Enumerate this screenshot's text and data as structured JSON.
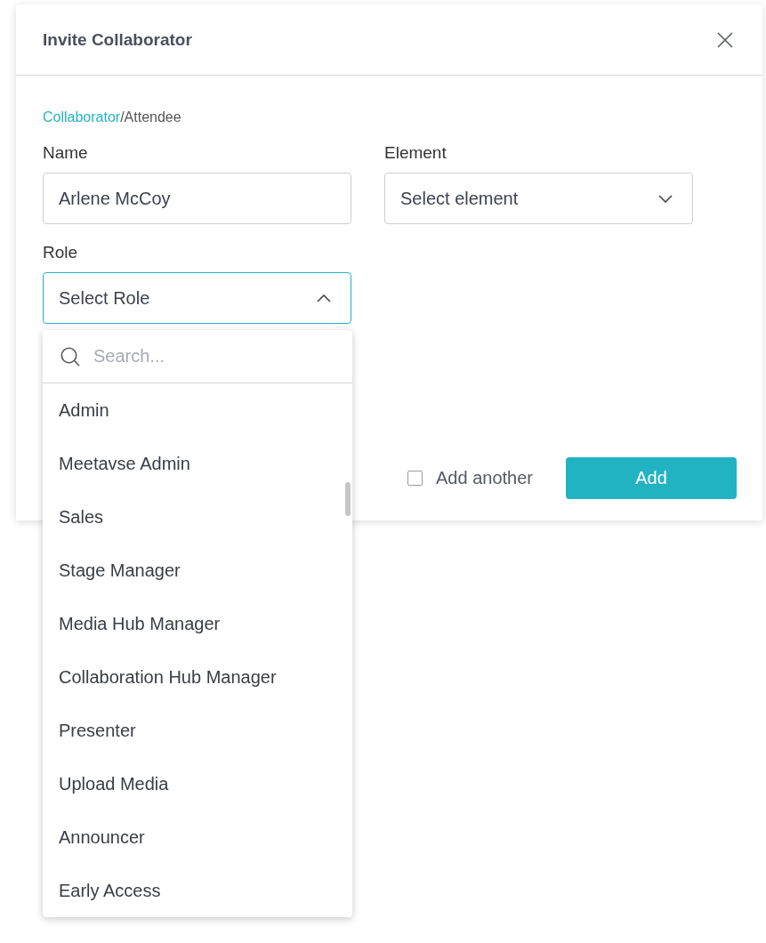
{
  "dialog": {
    "title": "Invite Collaborator"
  },
  "user_type": {
    "separator": "/",
    "options": [
      {
        "label": "Collaborator",
        "selected": true
      },
      {
        "label": "Attendee",
        "selected": false
      }
    ]
  },
  "form": {
    "name": {
      "label": "Name",
      "value": "Arlene McCoy"
    },
    "element": {
      "label": "Element",
      "placeholder": "Select element",
      "expanded": false
    },
    "role": {
      "label": "Role",
      "placeholder": "Select Role",
      "expanded": true,
      "search_placeholder": "Search...",
      "options": [
        {
          "label": "Admin",
          "selected": false
        },
        {
          "label": "Meetavse Admin",
          "selected": false
        },
        {
          "label": "Sales",
          "selected": false
        },
        {
          "label": "Stage Manager",
          "selected": false
        },
        {
          "label": "Media Hub Manager",
          "selected": false
        },
        {
          "label": "Collaboration Hub Manager",
          "selected": false
        },
        {
          "label": "Presenter",
          "selected": false
        },
        {
          "label": "Upload Media",
          "selected": false
        },
        {
          "label": "Announcer",
          "selected": false
        },
        {
          "label": "Early Access",
          "selected": false
        }
      ]
    }
  },
  "footer": {
    "add_another": {
      "label": "Add another",
      "checked": false
    },
    "button": "Add"
  }
}
